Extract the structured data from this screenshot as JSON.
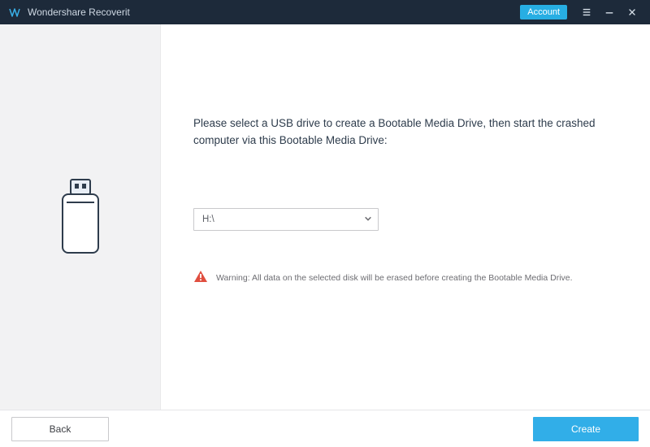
{
  "titlebar": {
    "app_name": "Wondershare Recoverit",
    "account_label": "Account"
  },
  "main": {
    "instruction": "Please select a USB drive to create a Bootable Media Drive, then start the crashed computer via this Bootable Media Drive:",
    "selected_drive": "H:\\",
    "warning_prefix": "Warning:",
    "warning_text": " All data on the selected disk will be erased before creating the Bootable Media Drive."
  },
  "footer": {
    "back_label": "Back",
    "create_label": "Create"
  },
  "colors": {
    "titlebar_bg": "#1d2a3a",
    "accent": "#31aee8",
    "warning": "#e04e3f"
  }
}
